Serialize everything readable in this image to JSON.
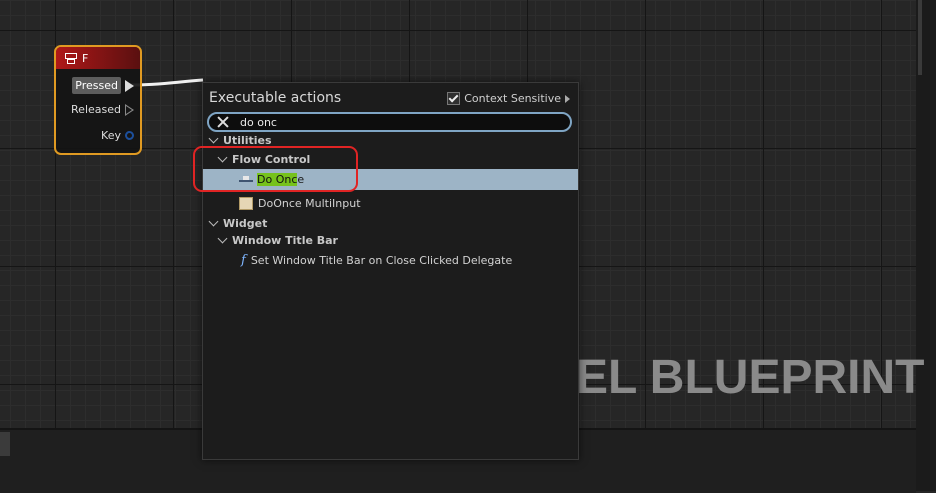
{
  "watermark": "EL BLUEPRINT",
  "event_node": {
    "title": "F",
    "pins": {
      "pressed": "Pressed",
      "released": "Released",
      "key": "Key"
    }
  },
  "popup": {
    "title": "Executable actions",
    "context_sensitive": {
      "label": "Context Sensitive",
      "checked": true
    },
    "search": {
      "value": "do onc",
      "placeholder": ""
    },
    "tree": {
      "utilities": "Utilities",
      "flow_control": "Flow Control",
      "do_once_match": "Do Onc",
      "do_once_rest": "e",
      "do_once_multiinput": "DoOnce MultiInput",
      "widget": "Widget",
      "window_title_bar": "Window Title Bar",
      "set_window_title": "Set Window Title Bar on Close Clicked Delegate"
    }
  },
  "colors": {
    "node_border": "#e09a22",
    "node_header": "#b01818",
    "selection": "#9db4c6",
    "match_highlight": "#76c21c",
    "annotation": "#e02424",
    "search_border": "#7fa5c4"
  },
  "icons": [
    "key-icon",
    "exec-pin-icon",
    "data-pin-icon",
    "checkbox-icon",
    "clear-icon",
    "chevron-down-icon",
    "do-once-icon",
    "multi-input-icon",
    "function-icon"
  ]
}
